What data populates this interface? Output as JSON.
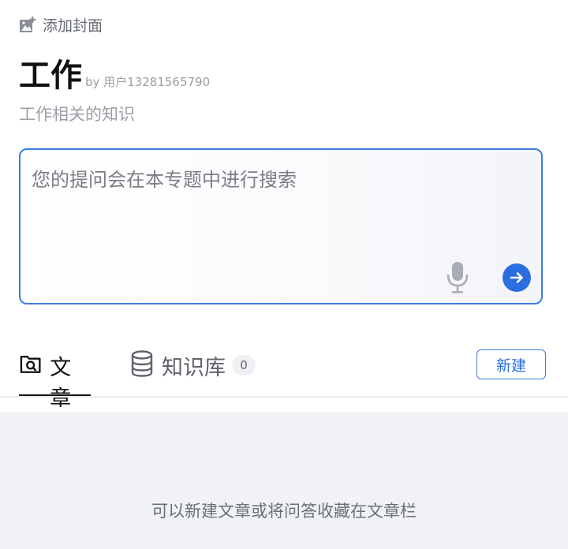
{
  "header": {
    "add_cover_label": "添加封面",
    "title": "工作",
    "byline": "by 用户13281565790",
    "subtitle": "工作相关的知识"
  },
  "ask": {
    "placeholder": "您的提问会在本专题中进行搜索"
  },
  "tabs": {
    "items": [
      {
        "label": "文章",
        "icon": "article-search-icon",
        "active": true
      },
      {
        "label": "知识库",
        "icon": "database-icon",
        "count": "0"
      }
    ],
    "new_label": "新建"
  },
  "content": {
    "empty_text": "可以新建文章或将问答收藏在文章栏"
  },
  "colors": {
    "accent": "#2b6ee0",
    "content_bg": "#f1f2f6"
  }
}
